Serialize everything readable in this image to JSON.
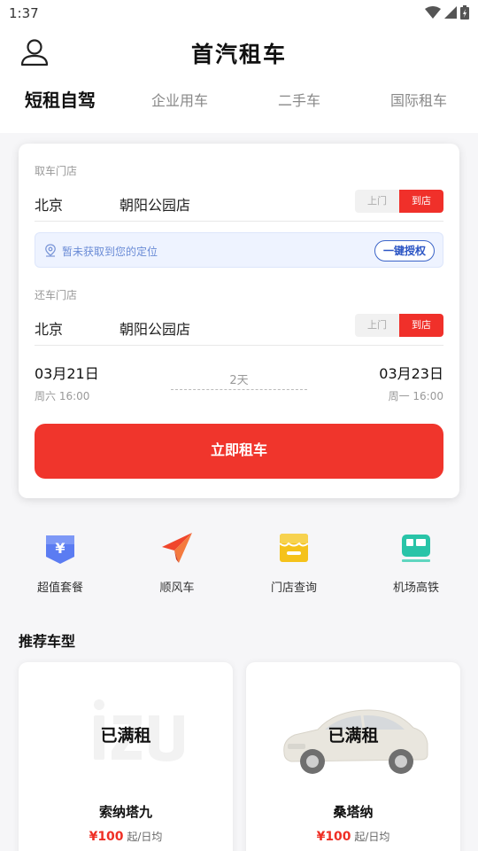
{
  "status": {
    "time": "1:37"
  },
  "header": {
    "title": "首汽租车"
  },
  "tabs": [
    {
      "label": "短租自驾",
      "active": true
    },
    {
      "label": "企业用车"
    },
    {
      "label": "二手车"
    },
    {
      "label": "国际租车"
    }
  ],
  "booking": {
    "pickup": {
      "label": "取车门店",
      "city": "北京",
      "store": "朝阳公园店",
      "options": [
        "上门",
        "到店"
      ],
      "selected": "到店"
    },
    "location_tip": {
      "text": "暂未获取到您的定位",
      "button": "一键授权"
    },
    "return": {
      "label": "还车门店",
      "city": "北京",
      "store": "朝阳公园店",
      "options": [
        "上门",
        "到店"
      ],
      "selected": "到店"
    },
    "start": {
      "date": "03月21日",
      "sub": "周六 16:00"
    },
    "end": {
      "date": "03月23日",
      "sub": "周一 16:00"
    },
    "duration": "2天",
    "submit": "立即租车"
  },
  "shortcuts": [
    {
      "label": "超值套餐",
      "icon": "yuan-tag-icon",
      "color": "#5b7cf2"
    },
    {
      "label": "顺风车",
      "icon": "paper-plane-icon",
      "color": "#f0462c"
    },
    {
      "label": "门店查询",
      "icon": "store-icon",
      "color": "#f5c21b"
    },
    {
      "label": "机场高铁",
      "icon": "train-icon",
      "color": "#29c4a8"
    }
  ],
  "recommend": {
    "title": "推荐车型",
    "cars": [
      {
        "name": "索纳塔九",
        "status": "已满租",
        "price": "¥100",
        "unit": "起/日均"
      },
      {
        "name": "桑塔纳",
        "status": "已满租",
        "price": "¥100",
        "unit": "起/日均"
      }
    ]
  },
  "colors": {
    "accent": "#f0302a",
    "link": "#2b55c4"
  }
}
